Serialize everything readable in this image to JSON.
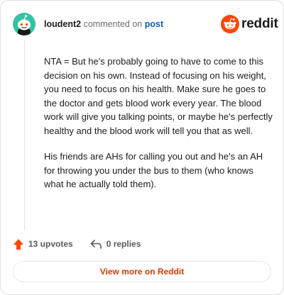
{
  "header": {
    "username": "loudent2",
    "action_text": "commented on",
    "post_link": "post"
  },
  "brand": {
    "wordmark": "reddit",
    "icon": "reddit-snoo-logo",
    "color": "#ff4500"
  },
  "comment": {
    "paragraphs": [
      "NTA = But he's probably going to have to come to this decision on his own. Instead of focusing on his weight, you need to focus on his health. Make sure he goes to the doctor and gets blood work every year. The blood work will give you talking points, or maybe he's perfectly healthy and the blood work will tell you that as well.",
      "His friends are AHs for calling you out and he's an AH for throwing you under the bus to them (who knows what he actually told them)."
    ]
  },
  "actions": {
    "upvotes_label": "13 upvotes",
    "replies_label": "0 replies",
    "upvote_icon": "upvote-arrow-icon",
    "reply_icon": "reply-arrow-icon",
    "upvote_color": "#ff4500"
  },
  "footer": {
    "view_more_label": "View more on Reddit",
    "accent": "#d93a00"
  }
}
